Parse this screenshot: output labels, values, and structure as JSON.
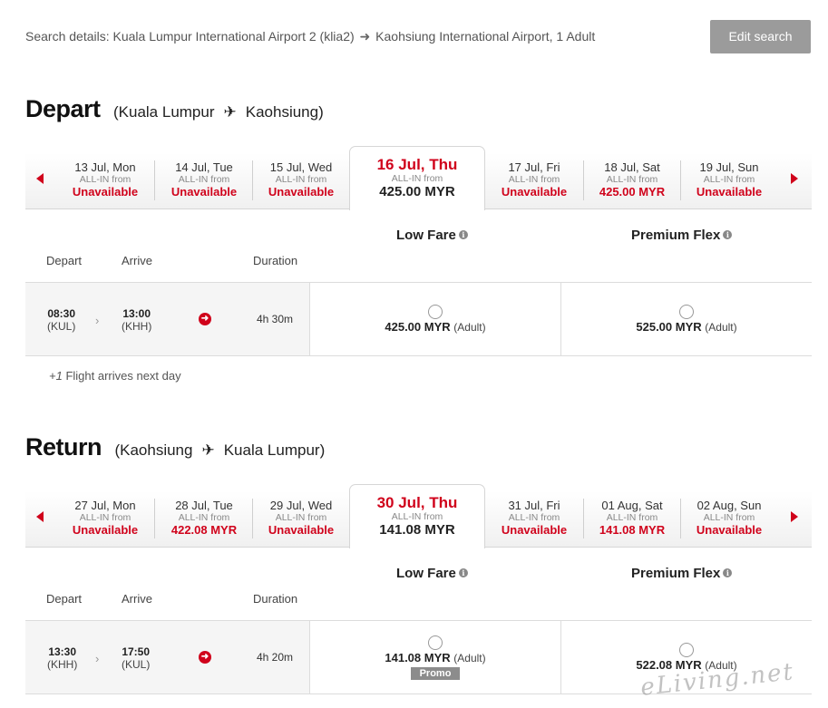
{
  "search": {
    "label": "Search details:",
    "origin": "Kuala Lumpur International Airport 2 (klia2)",
    "destination": "Kaohsiung International Airport, 1 Adult",
    "edit_label": "Edit search"
  },
  "depart": {
    "title": "Depart",
    "from": "Kuala Lumpur",
    "to": "Kaohsiung",
    "days": [
      {
        "date": "13 Jul, Mon",
        "from_label": "ALL-IN from",
        "price": "Unavailable"
      },
      {
        "date": "14 Jul, Tue",
        "from_label": "ALL-IN from",
        "price": "Unavailable"
      },
      {
        "date": "15 Jul, Wed",
        "from_label": "ALL-IN from",
        "price": "Unavailable"
      },
      {
        "date": "16 Jul, Thu",
        "from_label": "ALL-IN from",
        "price": "425.00 MYR"
      },
      {
        "date": "17 Jul, Fri",
        "from_label": "ALL-IN from",
        "price": "Unavailable"
      },
      {
        "date": "18 Jul, Sat",
        "from_label": "ALL-IN from",
        "price": "425.00 MYR"
      },
      {
        "date": "19 Jul, Sun",
        "from_label": "ALL-IN from",
        "price": "Unavailable"
      }
    ],
    "fare_headers": {
      "low": "Low Fare",
      "flex": "Premium Flex"
    },
    "columns": {
      "depart": "Depart",
      "arrive": "Arrive",
      "duration": "Duration"
    },
    "flight": {
      "dep_time": "08:30",
      "dep_code": "(KUL)",
      "arr_time": "13:00",
      "arr_code": "(KHH)",
      "duration": "4h 30m",
      "low_price": "425.00 MYR",
      "low_who": "(Adult)",
      "flex_price": "525.00 MYR",
      "flex_who": "(Adult)"
    },
    "note_mark": "+1",
    "note_text": " Flight arrives next day"
  },
  "return": {
    "title": "Return",
    "from": "Kaohsiung",
    "to": "Kuala Lumpur",
    "days": [
      {
        "date": "27 Jul, Mon",
        "from_label": "ALL-IN from",
        "price": "Unavailable"
      },
      {
        "date": "28 Jul, Tue",
        "from_label": "ALL-IN from",
        "price": "422.08 MYR"
      },
      {
        "date": "29 Jul, Wed",
        "from_label": "ALL-IN from",
        "price": "Unavailable"
      },
      {
        "date": "30 Jul, Thu",
        "from_label": "ALL-IN from",
        "price": "141.08 MYR"
      },
      {
        "date": "31 Jul, Fri",
        "from_label": "ALL-IN from",
        "price": "Unavailable"
      },
      {
        "date": "01 Aug, Sat",
        "from_label": "ALL-IN from",
        "price": "141.08 MYR"
      },
      {
        "date": "02 Aug, Sun",
        "from_label": "ALL-IN from",
        "price": "Unavailable"
      }
    ],
    "fare_headers": {
      "low": "Low Fare",
      "flex": "Premium Flex"
    },
    "columns": {
      "depart": "Depart",
      "arrive": "Arrive",
      "duration": "Duration"
    },
    "flight": {
      "dep_time": "13:30",
      "dep_code": "(KHH)",
      "arr_time": "17:50",
      "arr_code": "(KUL)",
      "duration": "4h 20m",
      "low_price": "141.08 MYR",
      "low_who": "(Adult)",
      "promo": "Promo",
      "flex_price": "522.08 MYR",
      "flex_who": "(Adult)"
    }
  },
  "watermark": "eLiving.net",
  "colors": {
    "accent": "#d0021b",
    "button": "#9b9b9b"
  }
}
